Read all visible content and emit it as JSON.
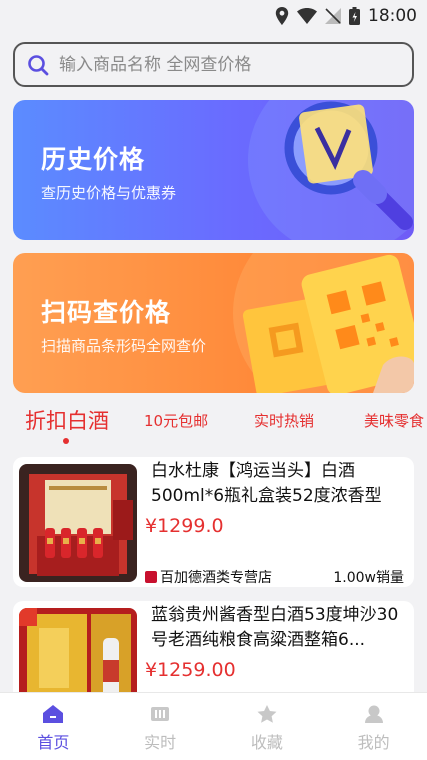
{
  "status_bar": {
    "time": "18:00"
  },
  "search": {
    "placeholder": "输入商品名称 全网查价格"
  },
  "banners": [
    {
      "title": "历史价格",
      "subtitle": "查历史价格与优惠券"
    },
    {
      "title": "扫码查价格",
      "subtitle": "扫描商品条形码全网查价"
    }
  ],
  "tabs": [
    {
      "label": "折扣白酒",
      "active": true
    },
    {
      "label": "10元包邮"
    },
    {
      "label": "实时热销"
    },
    {
      "label": "美味零食"
    }
  ],
  "products": [
    {
      "title": "白水杜康【鸿运当头】白酒500ml*6瓶礼盒装52度浓香型",
      "price": "¥1299.0",
      "shop": "百加德酒类专营店",
      "sales": "1.00w销量"
    },
    {
      "title": "蓝翁贵州酱香型白酒53度坤沙30号老酒纯粮食高粱酒整箱6...",
      "price": "¥1259.00"
    }
  ],
  "bottom_nav": [
    {
      "label": "首页",
      "icon": "home-icon",
      "active": true
    },
    {
      "label": "实时",
      "icon": "realtime-icon"
    },
    {
      "label": "收藏",
      "icon": "star-icon"
    },
    {
      "label": "我的",
      "icon": "profile-icon"
    }
  ],
  "colors": {
    "accent": "#5b4fe0",
    "price": "#e53030",
    "banner_blue": "#6a6bff",
    "banner_orange": "#ff8a3a"
  }
}
